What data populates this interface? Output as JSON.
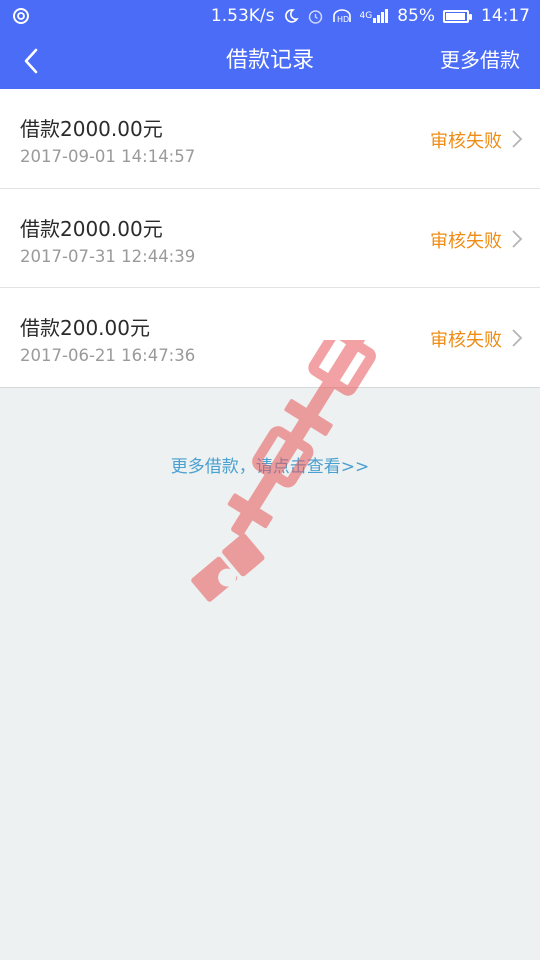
{
  "status_bar": {
    "speed": "1.53K/s",
    "network": "4G",
    "battery": "85%",
    "battery_level": 0.85,
    "time": "14:17",
    "icons": [
      "app-notification-icon",
      "moon-icon",
      "alarm-icon",
      "hd-icon",
      "signal-icon",
      "battery-icon"
    ]
  },
  "nav": {
    "back_icon": "chevron-left-icon",
    "title": "借款记录",
    "action": "更多借款"
  },
  "records": [
    {
      "title": "借款2000.00元",
      "time": "2017-09-01 14:14:57",
      "status": "审核失败"
    },
    {
      "title": "借款2000.00元",
      "time": "2017-07-31 12:44:39",
      "status": "审核失败"
    },
    {
      "title": "借款200.00元",
      "time": "2017-06-21 16:47:36",
      "status": "审核失败"
    }
  ],
  "more_link": "更多借款，请点击查看>>",
  "watermark": {
    "text": "卡农社区"
  },
  "colors": {
    "primary": "#4a6cf7",
    "status": "#ef8c14",
    "link": "#4aa0d0",
    "background": "#eef1f1"
  }
}
